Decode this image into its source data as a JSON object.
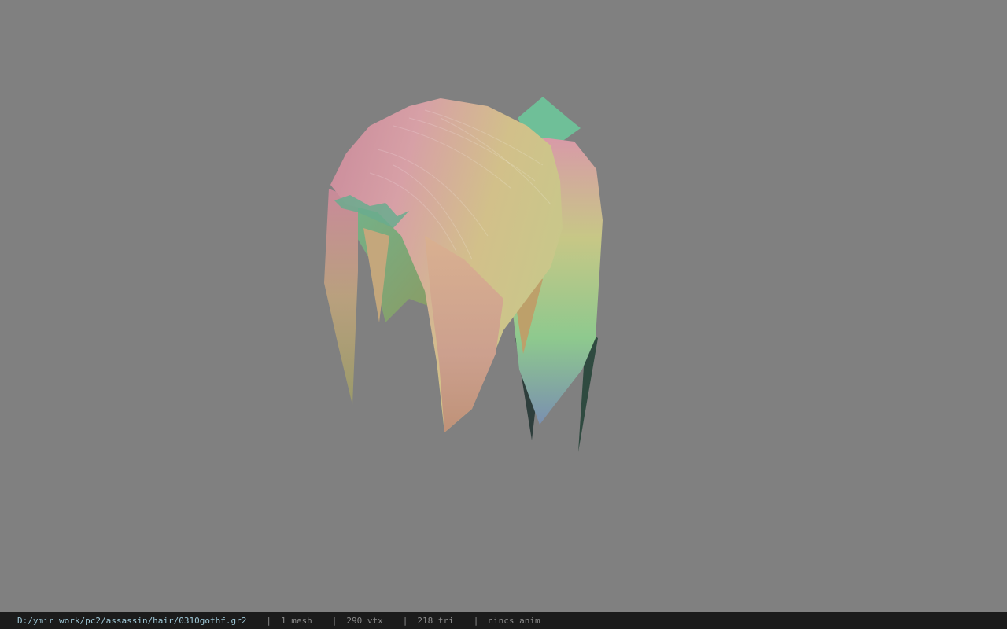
{
  "viewport": {
    "background": "#808080",
    "model_name": "hair-mesh"
  },
  "status_bar": {
    "file_path": "D:/ymir work/pc2/assassin/hair/0310gothf.gr2",
    "separator": "|",
    "mesh_count": "1 mesh",
    "vertex_count": "290 vtx",
    "triangle_count": "218 tri",
    "anim_status": "nincs anim",
    "path_color": "#9ec7d6",
    "text_color": "#8a8a8a",
    "background": "#1b1b1b"
  }
}
